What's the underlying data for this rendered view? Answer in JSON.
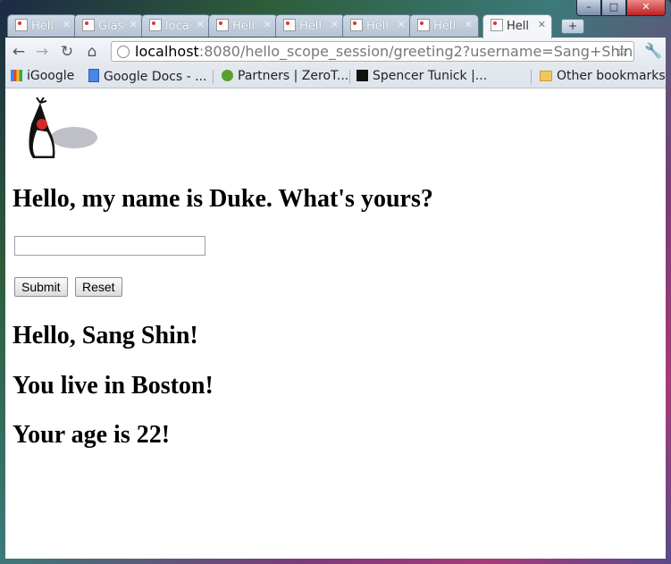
{
  "window": {
    "controls": [
      "minimize",
      "maximize",
      "close"
    ]
  },
  "tabs": [
    {
      "label": "Hell",
      "active": false
    },
    {
      "label": "Glas",
      "active": false
    },
    {
      "label": "loca",
      "active": false
    },
    {
      "label": "Hell",
      "active": false
    },
    {
      "label": "Hell",
      "active": false
    },
    {
      "label": "Hell",
      "active": false
    },
    {
      "label": "Hell",
      "active": false
    },
    {
      "label": "Hell",
      "active": true
    }
  ],
  "toolbar": {
    "url_host": "localhost",
    "url_rest": ":8080/hello_scope_session/greeting2?username=Sang+Shin"
  },
  "bookmarks": {
    "items": [
      {
        "label": "iGoogle",
        "icon": "google-icon"
      },
      {
        "label": "Google Docs - ...",
        "icon": "docs-icon"
      },
      {
        "label": "Partners | ZeroT...",
        "icon": "partners-icon"
      },
      {
        "label": "Spencer Tunick |...",
        "icon": "site-icon"
      }
    ],
    "other": "Other bookmarks"
  },
  "page": {
    "prompt": "Hello, my name is Duke. What's yours?",
    "input_value": "",
    "submit_label": "Submit",
    "reset_label": "Reset",
    "greeting": "Hello, Sang Shin!",
    "city_line": "You live in Boston!",
    "age_line": "Your age is 22!"
  },
  "colors": {
    "page_bg": "#ffffff",
    "chrome_frame": "#3b6a8a",
    "active_tab": "#f4f6f9"
  }
}
